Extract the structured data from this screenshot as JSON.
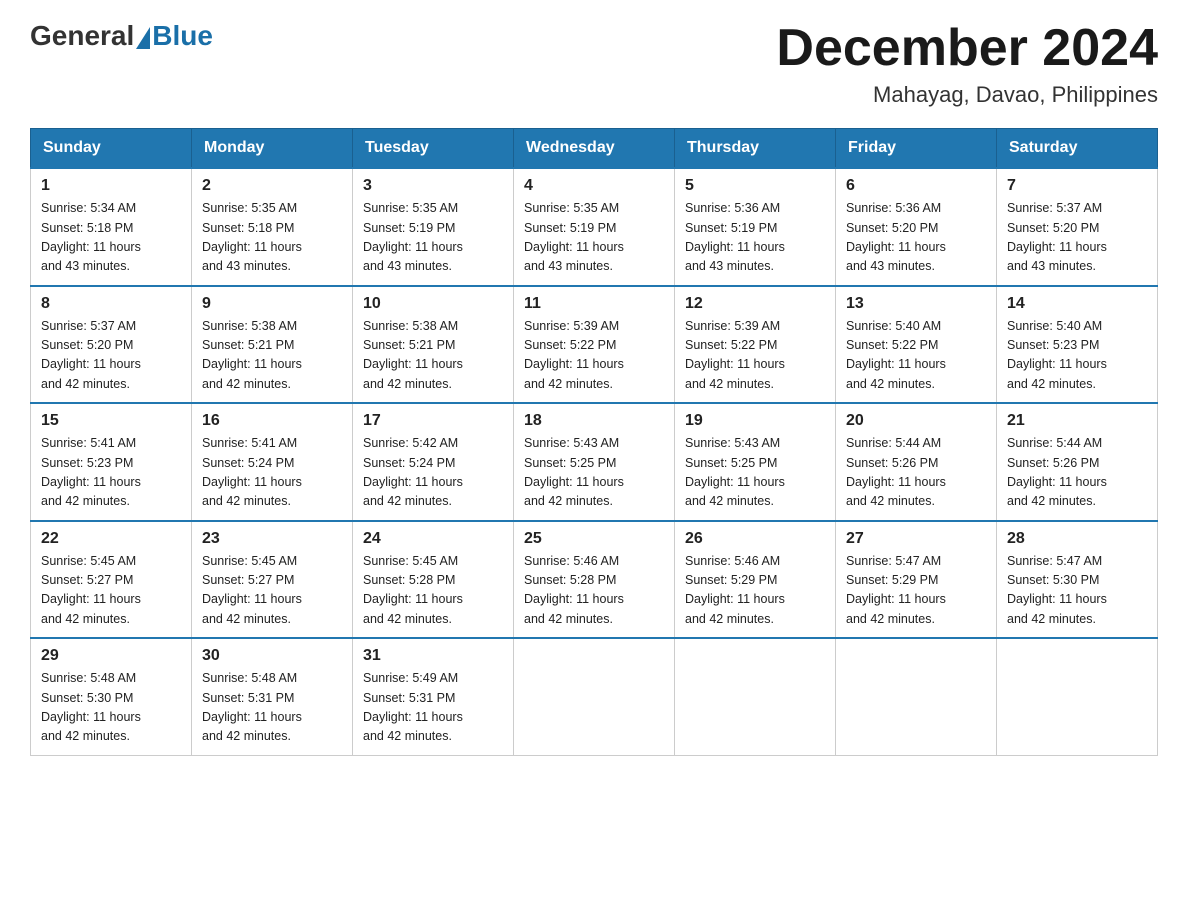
{
  "header": {
    "logo_general": "General",
    "logo_blue": "Blue",
    "month_title": "December 2024",
    "location": "Mahayag, Davao, Philippines"
  },
  "days_of_week": [
    "Sunday",
    "Monday",
    "Tuesday",
    "Wednesday",
    "Thursday",
    "Friday",
    "Saturday"
  ],
  "weeks": [
    [
      {
        "day": "1",
        "sunrise": "5:34 AM",
        "sunset": "5:18 PM",
        "daylight": "11 hours and 43 minutes."
      },
      {
        "day": "2",
        "sunrise": "5:35 AM",
        "sunset": "5:18 PM",
        "daylight": "11 hours and 43 minutes."
      },
      {
        "day": "3",
        "sunrise": "5:35 AM",
        "sunset": "5:19 PM",
        "daylight": "11 hours and 43 minutes."
      },
      {
        "day": "4",
        "sunrise": "5:35 AM",
        "sunset": "5:19 PM",
        "daylight": "11 hours and 43 minutes."
      },
      {
        "day": "5",
        "sunrise": "5:36 AM",
        "sunset": "5:19 PM",
        "daylight": "11 hours and 43 minutes."
      },
      {
        "day": "6",
        "sunrise": "5:36 AM",
        "sunset": "5:20 PM",
        "daylight": "11 hours and 43 minutes."
      },
      {
        "day": "7",
        "sunrise": "5:37 AM",
        "sunset": "5:20 PM",
        "daylight": "11 hours and 43 minutes."
      }
    ],
    [
      {
        "day": "8",
        "sunrise": "5:37 AM",
        "sunset": "5:20 PM",
        "daylight": "11 hours and 42 minutes."
      },
      {
        "day": "9",
        "sunrise": "5:38 AM",
        "sunset": "5:21 PM",
        "daylight": "11 hours and 42 minutes."
      },
      {
        "day": "10",
        "sunrise": "5:38 AM",
        "sunset": "5:21 PM",
        "daylight": "11 hours and 42 minutes."
      },
      {
        "day": "11",
        "sunrise": "5:39 AM",
        "sunset": "5:22 PM",
        "daylight": "11 hours and 42 minutes."
      },
      {
        "day": "12",
        "sunrise": "5:39 AM",
        "sunset": "5:22 PM",
        "daylight": "11 hours and 42 minutes."
      },
      {
        "day": "13",
        "sunrise": "5:40 AM",
        "sunset": "5:22 PM",
        "daylight": "11 hours and 42 minutes."
      },
      {
        "day": "14",
        "sunrise": "5:40 AM",
        "sunset": "5:23 PM",
        "daylight": "11 hours and 42 minutes."
      }
    ],
    [
      {
        "day": "15",
        "sunrise": "5:41 AM",
        "sunset": "5:23 PM",
        "daylight": "11 hours and 42 minutes."
      },
      {
        "day": "16",
        "sunrise": "5:41 AM",
        "sunset": "5:24 PM",
        "daylight": "11 hours and 42 minutes."
      },
      {
        "day": "17",
        "sunrise": "5:42 AM",
        "sunset": "5:24 PM",
        "daylight": "11 hours and 42 minutes."
      },
      {
        "day": "18",
        "sunrise": "5:43 AM",
        "sunset": "5:25 PM",
        "daylight": "11 hours and 42 minutes."
      },
      {
        "day": "19",
        "sunrise": "5:43 AM",
        "sunset": "5:25 PM",
        "daylight": "11 hours and 42 minutes."
      },
      {
        "day": "20",
        "sunrise": "5:44 AM",
        "sunset": "5:26 PM",
        "daylight": "11 hours and 42 minutes."
      },
      {
        "day": "21",
        "sunrise": "5:44 AM",
        "sunset": "5:26 PM",
        "daylight": "11 hours and 42 minutes."
      }
    ],
    [
      {
        "day": "22",
        "sunrise": "5:45 AM",
        "sunset": "5:27 PM",
        "daylight": "11 hours and 42 minutes."
      },
      {
        "day": "23",
        "sunrise": "5:45 AM",
        "sunset": "5:27 PM",
        "daylight": "11 hours and 42 minutes."
      },
      {
        "day": "24",
        "sunrise": "5:45 AM",
        "sunset": "5:28 PM",
        "daylight": "11 hours and 42 minutes."
      },
      {
        "day": "25",
        "sunrise": "5:46 AM",
        "sunset": "5:28 PM",
        "daylight": "11 hours and 42 minutes."
      },
      {
        "day": "26",
        "sunrise": "5:46 AM",
        "sunset": "5:29 PM",
        "daylight": "11 hours and 42 minutes."
      },
      {
        "day": "27",
        "sunrise": "5:47 AM",
        "sunset": "5:29 PM",
        "daylight": "11 hours and 42 minutes."
      },
      {
        "day": "28",
        "sunrise": "5:47 AM",
        "sunset": "5:30 PM",
        "daylight": "11 hours and 42 minutes."
      }
    ],
    [
      {
        "day": "29",
        "sunrise": "5:48 AM",
        "sunset": "5:30 PM",
        "daylight": "11 hours and 42 minutes."
      },
      {
        "day": "30",
        "sunrise": "5:48 AM",
        "sunset": "5:31 PM",
        "daylight": "11 hours and 42 minutes."
      },
      {
        "day": "31",
        "sunrise": "5:49 AM",
        "sunset": "5:31 PM",
        "daylight": "11 hours and 42 minutes."
      },
      null,
      null,
      null,
      null
    ]
  ],
  "labels": {
    "sunrise_prefix": "Sunrise: ",
    "sunset_prefix": "Sunset: ",
    "daylight_prefix": "Daylight: "
  }
}
